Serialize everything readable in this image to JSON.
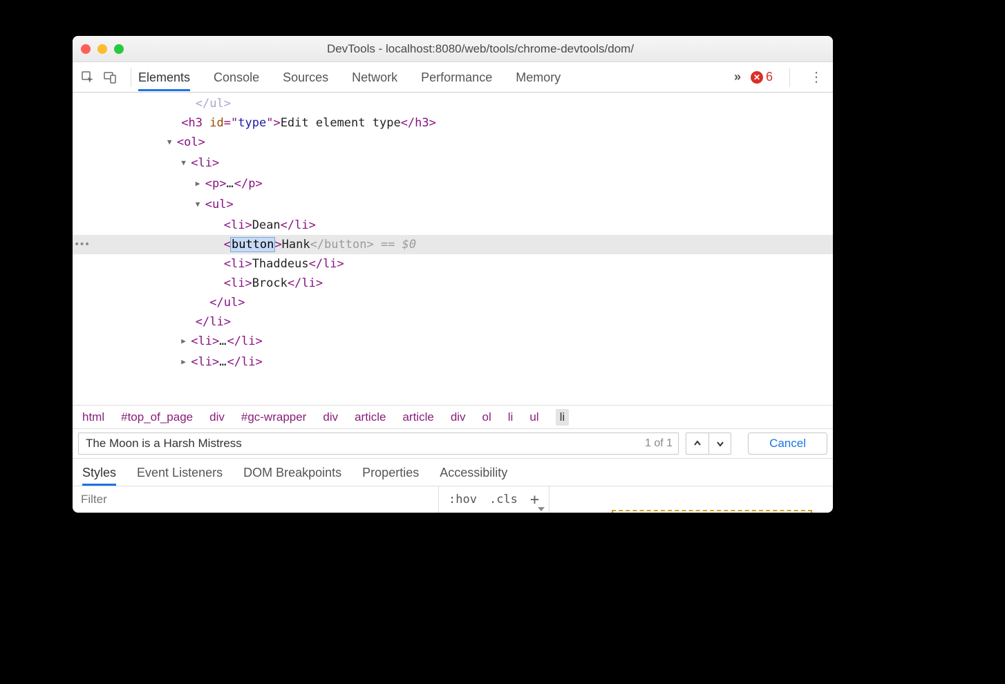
{
  "window": {
    "title": "DevTools - localhost:8080/web/tools/chrome-devtools/dom/"
  },
  "toolbar": {
    "tabs": [
      "Elements",
      "Console",
      "Sources",
      "Network",
      "Performance",
      "Memory"
    ],
    "overflow": "»",
    "error_count": "6"
  },
  "dom": {
    "cut_line": "</ul>",
    "h3_id": "type",
    "h3_text": "Edit element type",
    "items": {
      "dean": "Dean",
      "hank": "Hank",
      "thaddeus": "Thaddeus",
      "brock": "Brock"
    },
    "selected_tag": "button",
    "eq0": " == $0"
  },
  "breadcrumb": [
    "html",
    "#top_of_page",
    "div",
    "#gc-wrapper",
    "div",
    "article",
    "article",
    "div",
    "ol",
    "li",
    "ul",
    "li"
  ],
  "search": {
    "value": "The Moon is a Harsh Mistress",
    "count": "1 of 1",
    "cancel": "Cancel"
  },
  "lower_tabs": [
    "Styles",
    "Event Listeners",
    "DOM Breakpoints",
    "Properties",
    "Accessibility"
  ],
  "styles": {
    "filter_placeholder": "Filter",
    "hov": ":hov",
    "cls": ".cls"
  }
}
